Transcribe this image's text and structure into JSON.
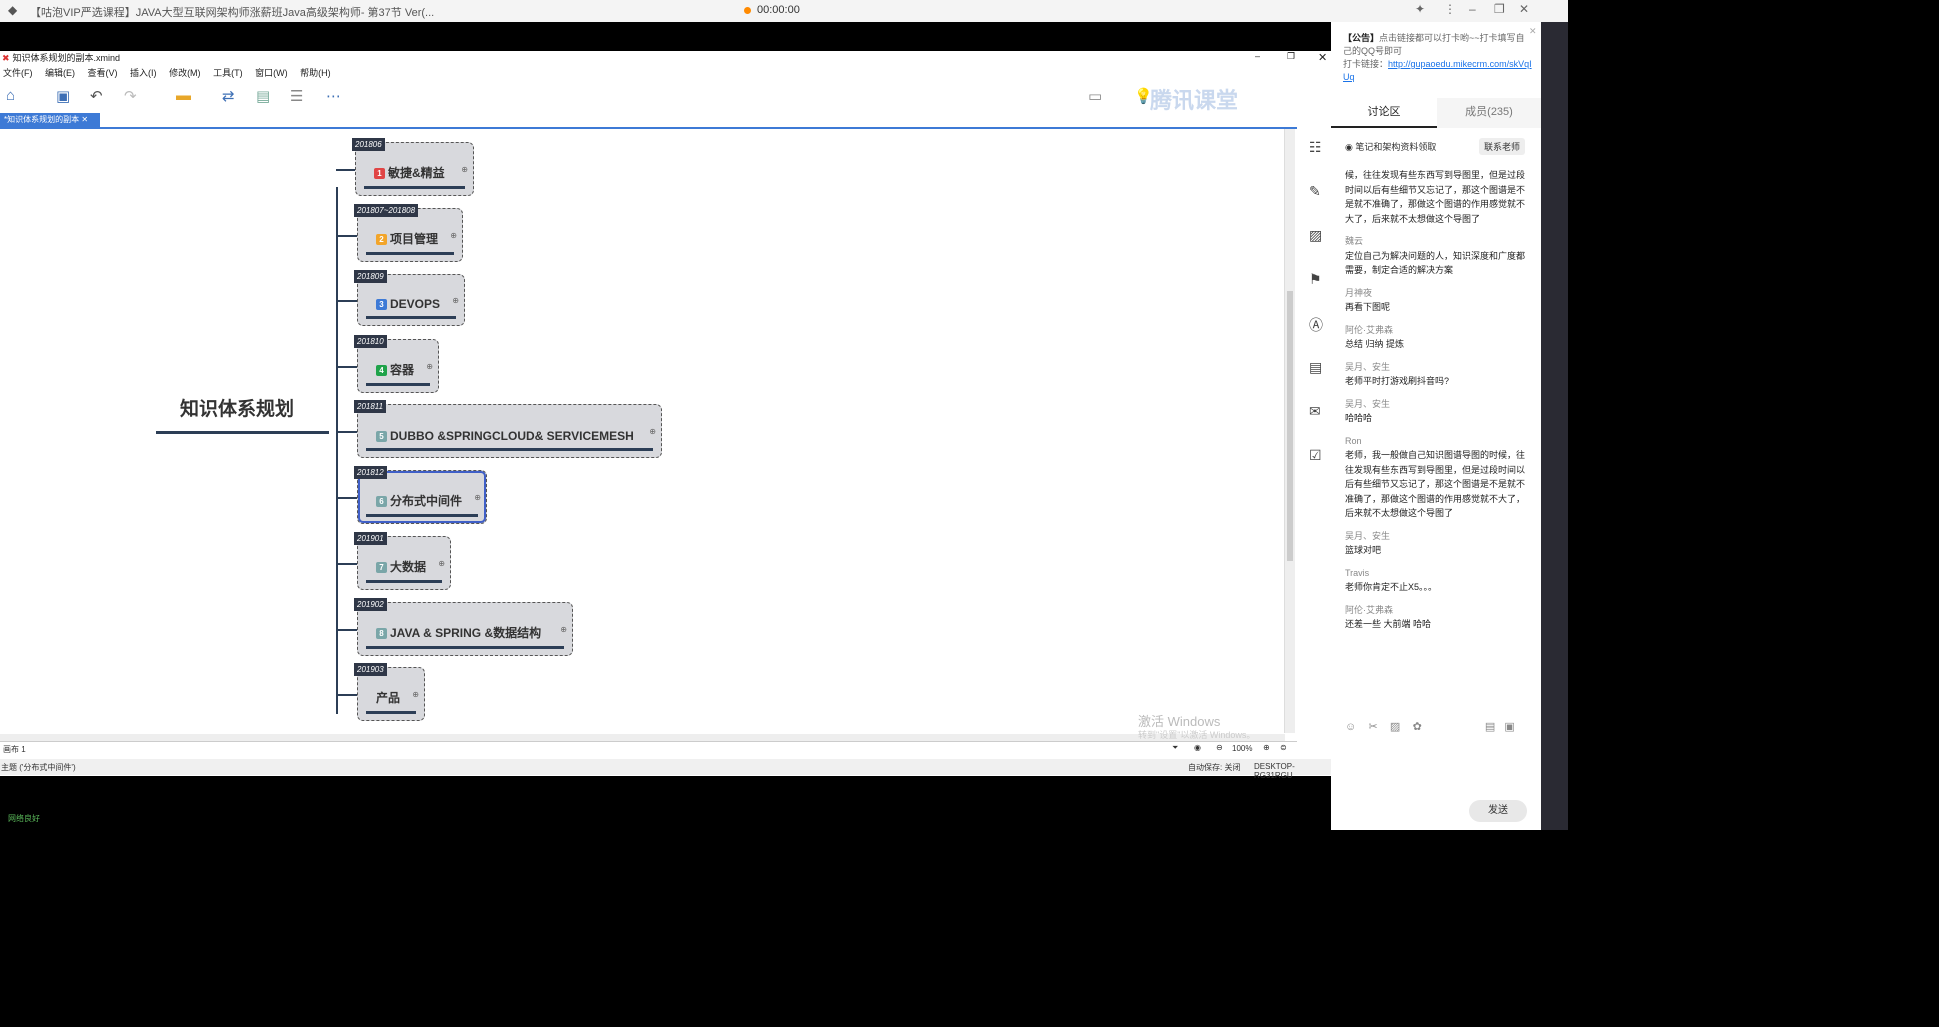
{
  "player": {
    "title": "【咕泡VIP严选课程】JAVA大型互联网架构师涨薪班Java高级架构师- 第37节 Ver(...",
    "timer": "00:00:00"
  },
  "xmind": {
    "filename": "知识体系规划的副本.xmind",
    "menu": [
      "文件(F)",
      "编辑(E)",
      "查看(V)",
      "插入(I)",
      "修改(M)",
      "工具(T)",
      "窗口(W)",
      "帮助(H)"
    ],
    "tab": "*知识体系规划的副本",
    "watermark": "腾讯课堂",
    "root": "知识体系规划",
    "nodes": [
      {
        "date": "201806",
        "num": "1",
        "label": "敏捷&精益",
        "color": "#e04545"
      },
      {
        "date": "201807~201808",
        "num": "2",
        "label": "项目管理",
        "color": "#f2a52a"
      },
      {
        "date": "201809",
        "num": "3",
        "label": "DEVOPS",
        "color": "#3d7ad6"
      },
      {
        "date": "201810",
        "num": "4",
        "label": "容器",
        "color": "#1fa34a"
      },
      {
        "date": "201811",
        "num": "5",
        "label": "DUBBO &SPRINGCLOUD& SERVICEMESH",
        "color": "#7aa6a8"
      },
      {
        "date": "201812",
        "num": "6",
        "label": "分布式中间件",
        "color": "#7aa6a8"
      },
      {
        "date": "201901",
        "num": "7",
        "label": "大数据",
        "color": "#7aa6a8"
      },
      {
        "date": "201902",
        "num": "8",
        "label": "JAVA & SPRING &数据结构",
        "color": "#7aa6a8"
      },
      {
        "date": "201903",
        "num": "",
        "label": "产品",
        "color": "#7aa6a8"
      }
    ],
    "activate": "激活 Windows",
    "activate_sub": "转到\"设置\"以激活 Windows。",
    "sheet": "画布 1",
    "zoom": "100%",
    "topic_status": "主题 ('分布式中间件')",
    "autosave": "自动保存: 关闭",
    "machine": "DESKTOP-RG31RGU"
  },
  "panel": {
    "announce_label": "【公告】",
    "announce_text": "点击链接都可以打卡哟~~打卡填写自己的QQ号即可",
    "link_label": "打卡链接：",
    "link": "http://gupaoedu.mikecrm.com/skVqIUq",
    "tab_discuss": "讨论区",
    "tab_members": "成员(235)",
    "notice": "笔记和架构资料领取",
    "contact": "联系老师",
    "messages": [
      {
        "name": "",
        "text": "候，往往发现有些东西写到导图里，但是过段时间以后有些细节又忘记了，那这个图谱是不是就不准确了，那做这个图谱的作用感觉就不大了，后来就不太想做这个导图了"
      },
      {
        "name": "魏云",
        "text": "定位自己为解决问题的人，知识深度和广度都需要，制定合适的解决方案"
      },
      {
        "name": "月神夜",
        "text": "再看下图呢"
      },
      {
        "name": "阿伦·艾弗森",
        "text": "总结 归纳 提炼"
      },
      {
        "name": "吴月、安生",
        "text": "老师平时打游戏刷抖音吗?"
      },
      {
        "name": "吴月、安生",
        "text": "哈哈哈"
      },
      {
        "name": "Ron",
        "text": "老师，我一般做自己知识图谱导图的时候，往往发现有些东西写到导图里，但是过段时间以后有些细节又忘记了，那这个图谱是不是就不准确了，那做这个图谱的作用感觉就不大了，后来就不太想做这个导图了"
      },
      {
        "name": "吴月、安生",
        "text": "篮球对吧"
      },
      {
        "name": "Travis",
        "text": "老师你肯定不止X5。。。"
      },
      {
        "name": "阿伦·艾弗森",
        "text": "还差一些 大前端 哈哈"
      }
    ],
    "send": "发送",
    "network": "网络良好"
  }
}
